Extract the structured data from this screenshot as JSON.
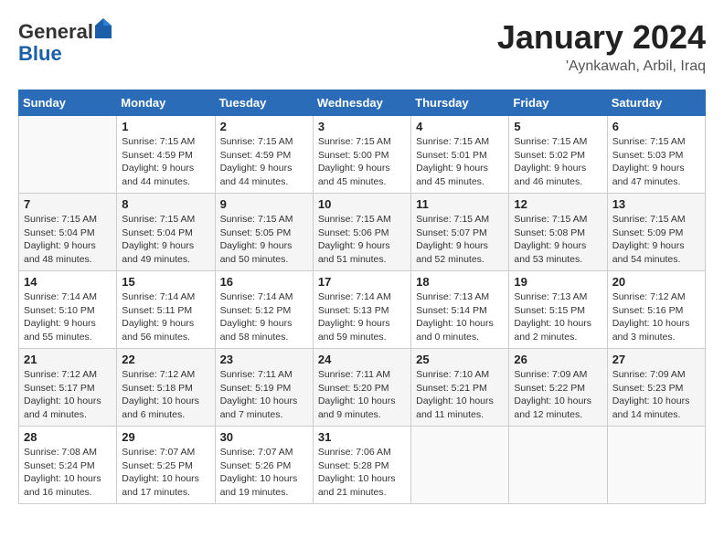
{
  "header": {
    "logo_general": "General",
    "logo_blue": "Blue",
    "month": "January 2024",
    "location": "'Aynkawah, Arbil, Iraq"
  },
  "weekdays": [
    "Sunday",
    "Monday",
    "Tuesday",
    "Wednesday",
    "Thursday",
    "Friday",
    "Saturday"
  ],
  "weeks": [
    [
      {
        "day": "",
        "info": ""
      },
      {
        "day": "1",
        "info": "Sunrise: 7:15 AM\nSunset: 4:59 PM\nDaylight: 9 hours\nand 44 minutes."
      },
      {
        "day": "2",
        "info": "Sunrise: 7:15 AM\nSunset: 4:59 PM\nDaylight: 9 hours\nand 44 minutes."
      },
      {
        "day": "3",
        "info": "Sunrise: 7:15 AM\nSunset: 5:00 PM\nDaylight: 9 hours\nand 45 minutes."
      },
      {
        "day": "4",
        "info": "Sunrise: 7:15 AM\nSunset: 5:01 PM\nDaylight: 9 hours\nand 45 minutes."
      },
      {
        "day": "5",
        "info": "Sunrise: 7:15 AM\nSunset: 5:02 PM\nDaylight: 9 hours\nand 46 minutes."
      },
      {
        "day": "6",
        "info": "Sunrise: 7:15 AM\nSunset: 5:03 PM\nDaylight: 9 hours\nand 47 minutes."
      }
    ],
    [
      {
        "day": "7",
        "info": "Sunrise: 7:15 AM\nSunset: 5:04 PM\nDaylight: 9 hours\nand 48 minutes."
      },
      {
        "day": "8",
        "info": "Sunrise: 7:15 AM\nSunset: 5:04 PM\nDaylight: 9 hours\nand 49 minutes."
      },
      {
        "day": "9",
        "info": "Sunrise: 7:15 AM\nSunset: 5:05 PM\nDaylight: 9 hours\nand 50 minutes."
      },
      {
        "day": "10",
        "info": "Sunrise: 7:15 AM\nSunset: 5:06 PM\nDaylight: 9 hours\nand 51 minutes."
      },
      {
        "day": "11",
        "info": "Sunrise: 7:15 AM\nSunset: 5:07 PM\nDaylight: 9 hours\nand 52 minutes."
      },
      {
        "day": "12",
        "info": "Sunrise: 7:15 AM\nSunset: 5:08 PM\nDaylight: 9 hours\nand 53 minutes."
      },
      {
        "day": "13",
        "info": "Sunrise: 7:15 AM\nSunset: 5:09 PM\nDaylight: 9 hours\nand 54 minutes."
      }
    ],
    [
      {
        "day": "14",
        "info": "Sunrise: 7:14 AM\nSunset: 5:10 PM\nDaylight: 9 hours\nand 55 minutes."
      },
      {
        "day": "15",
        "info": "Sunrise: 7:14 AM\nSunset: 5:11 PM\nDaylight: 9 hours\nand 56 minutes."
      },
      {
        "day": "16",
        "info": "Sunrise: 7:14 AM\nSunset: 5:12 PM\nDaylight: 9 hours\nand 58 minutes."
      },
      {
        "day": "17",
        "info": "Sunrise: 7:14 AM\nSunset: 5:13 PM\nDaylight: 9 hours\nand 59 minutes."
      },
      {
        "day": "18",
        "info": "Sunrise: 7:13 AM\nSunset: 5:14 PM\nDaylight: 10 hours\nand 0 minutes."
      },
      {
        "day": "19",
        "info": "Sunrise: 7:13 AM\nSunset: 5:15 PM\nDaylight: 10 hours\nand 2 minutes."
      },
      {
        "day": "20",
        "info": "Sunrise: 7:12 AM\nSunset: 5:16 PM\nDaylight: 10 hours\nand 3 minutes."
      }
    ],
    [
      {
        "day": "21",
        "info": "Sunrise: 7:12 AM\nSunset: 5:17 PM\nDaylight: 10 hours\nand 4 minutes."
      },
      {
        "day": "22",
        "info": "Sunrise: 7:12 AM\nSunset: 5:18 PM\nDaylight: 10 hours\nand 6 minutes."
      },
      {
        "day": "23",
        "info": "Sunrise: 7:11 AM\nSunset: 5:19 PM\nDaylight: 10 hours\nand 7 minutes."
      },
      {
        "day": "24",
        "info": "Sunrise: 7:11 AM\nSunset: 5:20 PM\nDaylight: 10 hours\nand 9 minutes."
      },
      {
        "day": "25",
        "info": "Sunrise: 7:10 AM\nSunset: 5:21 PM\nDaylight: 10 hours\nand 11 minutes."
      },
      {
        "day": "26",
        "info": "Sunrise: 7:09 AM\nSunset: 5:22 PM\nDaylight: 10 hours\nand 12 minutes."
      },
      {
        "day": "27",
        "info": "Sunrise: 7:09 AM\nSunset: 5:23 PM\nDaylight: 10 hours\nand 14 minutes."
      }
    ],
    [
      {
        "day": "28",
        "info": "Sunrise: 7:08 AM\nSunset: 5:24 PM\nDaylight: 10 hours\nand 16 minutes."
      },
      {
        "day": "29",
        "info": "Sunrise: 7:07 AM\nSunset: 5:25 PM\nDaylight: 10 hours\nand 17 minutes."
      },
      {
        "day": "30",
        "info": "Sunrise: 7:07 AM\nSunset: 5:26 PM\nDaylight: 10 hours\nand 19 minutes."
      },
      {
        "day": "31",
        "info": "Sunrise: 7:06 AM\nSunset: 5:28 PM\nDaylight: 10 hours\nand 21 minutes."
      },
      {
        "day": "",
        "info": ""
      },
      {
        "day": "",
        "info": ""
      },
      {
        "day": "",
        "info": ""
      }
    ]
  ]
}
